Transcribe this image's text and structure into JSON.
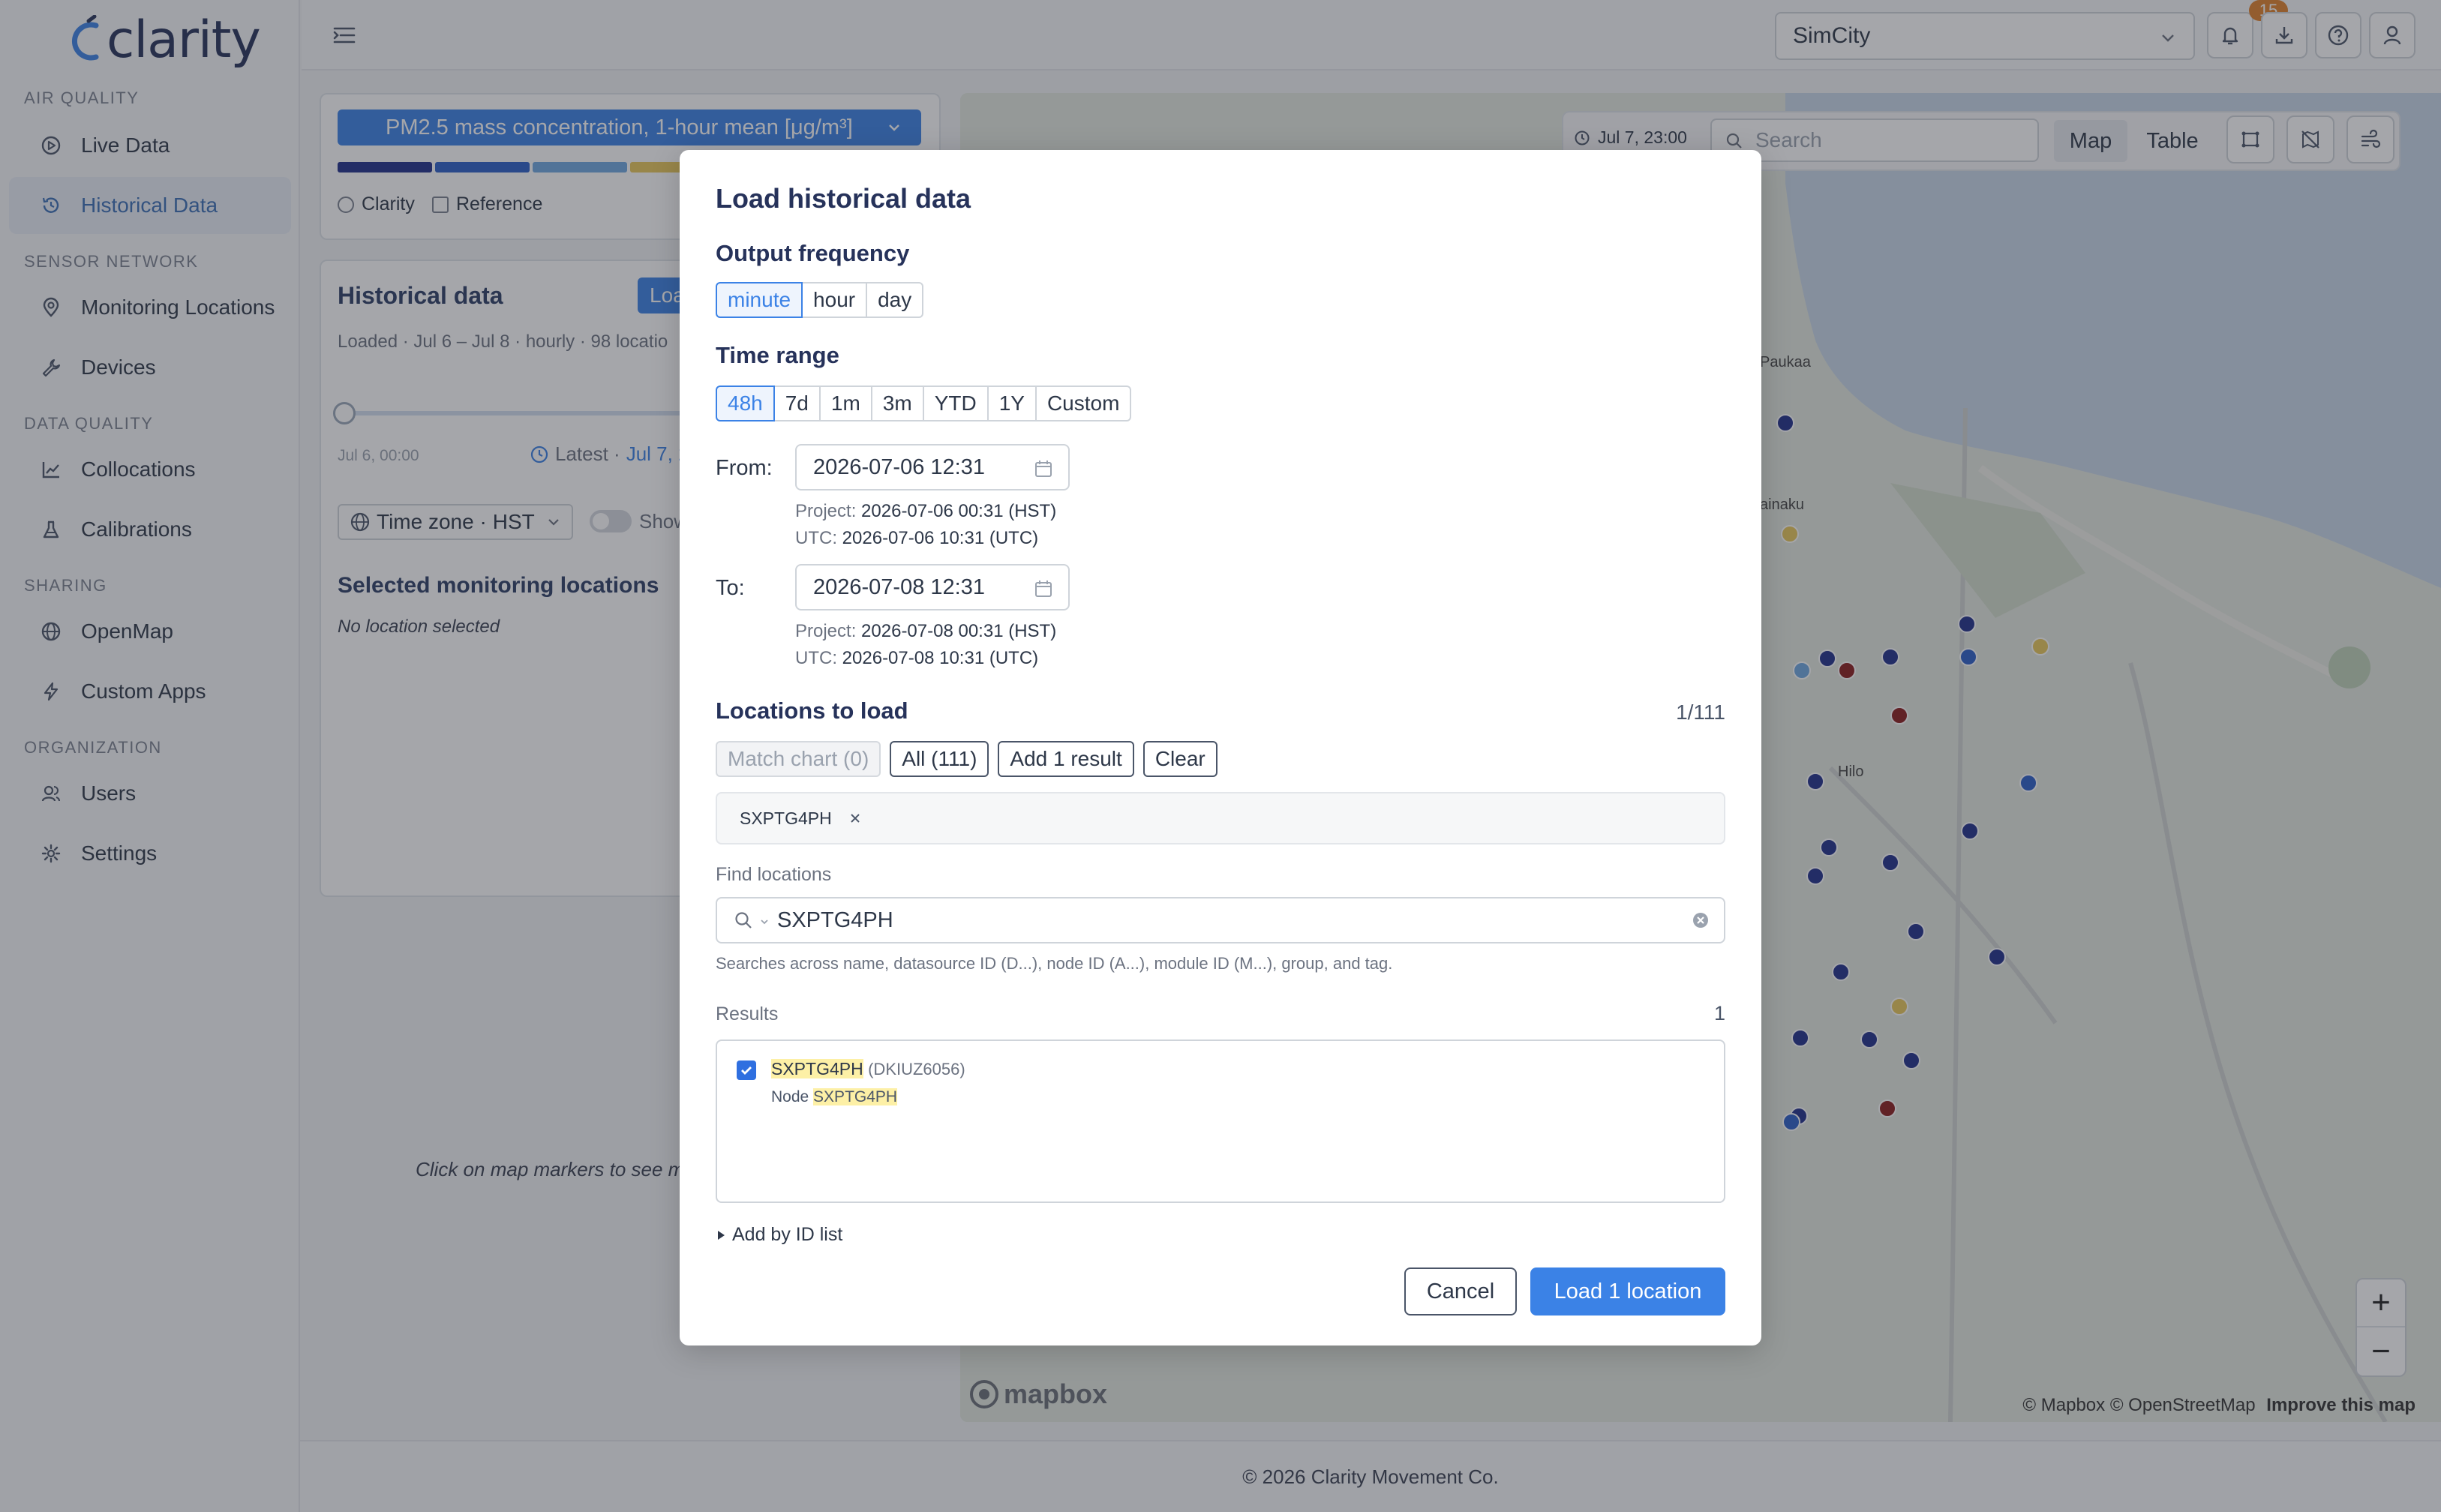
{
  "app": {
    "logo_text": "clarity",
    "brand_color": "#26325a",
    "accent_color": "#3b82e6"
  },
  "sidebar": {
    "sections": [
      {
        "label": "AIR QUALITY"
      },
      {
        "label": "SENSOR NETWORK"
      },
      {
        "label": "DATA QUALITY"
      },
      {
        "label": "SHARING"
      },
      {
        "label": "ORGANIZATION"
      }
    ],
    "items": [
      {
        "label": "Live Data",
        "icon": "play-circle-icon"
      },
      {
        "label": "Historical Data",
        "icon": "history-icon",
        "active": true
      },
      {
        "label": "Monitoring Locations",
        "icon": "map-pin-icon"
      },
      {
        "label": "Devices",
        "icon": "wrench-icon"
      },
      {
        "label": "Collocations",
        "icon": "line-chart-icon"
      },
      {
        "label": "Calibrations",
        "icon": "flask-icon"
      },
      {
        "label": "OpenMap",
        "icon": "globe-icon"
      },
      {
        "label": "Custom Apps",
        "icon": "lightning-icon"
      },
      {
        "label": "Users",
        "icon": "users-icon"
      },
      {
        "label": "Settings",
        "icon": "gear-icon"
      }
    ]
  },
  "topbar": {
    "project": "SimCity",
    "notification_count": "15"
  },
  "left_panel": {
    "metric": "PM2.5 mass concentration, 1-hour mean [μg/m³]",
    "source_clarity": "Clarity",
    "source_reference": "Reference",
    "historical_title": "Historical data",
    "load_btn": "Loa",
    "loaded_summary": "Loaded · Jul 6 – Jul 8 · hourly · 98 locatio",
    "slider_start": "Jul 6, 00:00",
    "latest": "Latest · ",
    "latest_value": "Jul 7, 2",
    "timezone_label": "Time zone · ",
    "timezone_value": "HST",
    "show_label": "Show",
    "selected_title": "Selected monitoring locations",
    "no_location": "No location selected",
    "click_hint": "Click on map markers to see m"
  },
  "map": {
    "time": "Jul 7, 23:00",
    "search_placeholder": "Search",
    "view_map": "Map",
    "view_table": "Table",
    "places": [
      "Paukaa",
      "ainaku",
      "Hilo"
    ],
    "zoom_in": "+",
    "zoom_out": "−",
    "attribution": "© Mapbox © OpenStreetMap",
    "improve": "Improve this map",
    "logo": "mapbox"
  },
  "footer": {
    "text": "© 2026 Clarity Movement Co."
  },
  "modal": {
    "title": "Load historical data",
    "output_frequency": {
      "title": "Output frequency",
      "options": [
        "minute",
        "hour",
        "day"
      ],
      "selected": "minute"
    },
    "time_range": {
      "title": "Time range",
      "options": [
        "48h",
        "7d",
        "1m",
        "3m",
        "YTD",
        "1Y",
        "Custom"
      ],
      "selected": "48h"
    },
    "from": {
      "label": "From:",
      "value": "2026-07-06 12:31",
      "project_label": "Project:",
      "project_value": "2026-07-06 00:31 (HST)",
      "utc_label": "UTC:",
      "utc_value": "2026-07-06 10:31 (UTC)"
    },
    "to": {
      "label": "To:",
      "value": "2026-07-08 12:31",
      "project_label": "Project:",
      "project_value": "2026-07-08 00:31 (HST)",
      "utc_label": "UTC:",
      "utc_value": "2026-07-08 10:31 (UTC)"
    },
    "locations": {
      "title": "Locations to load",
      "count": "1/111",
      "match_chart": "Match chart (0)",
      "all": "All (111)",
      "add_result": "Add 1 result",
      "clear": "Clear",
      "chip": "SXPTG4PH"
    },
    "find": {
      "label": "Find locations",
      "value": "SXPTG4PH",
      "help": "Searches across name, datasource ID (D...), node ID (A...), module ID (M...), group, and tag."
    },
    "results": {
      "label": "Results",
      "count": "1",
      "items": [
        {
          "name": "SXPTG4PH",
          "id": "(DKIUZ6056)",
          "node_prefix": "Node ",
          "node": "SXPTG4PH",
          "checked": true
        }
      ]
    },
    "add_by_id": "Add by ID list",
    "cancel": "Cancel",
    "load": "Load 1 location"
  }
}
